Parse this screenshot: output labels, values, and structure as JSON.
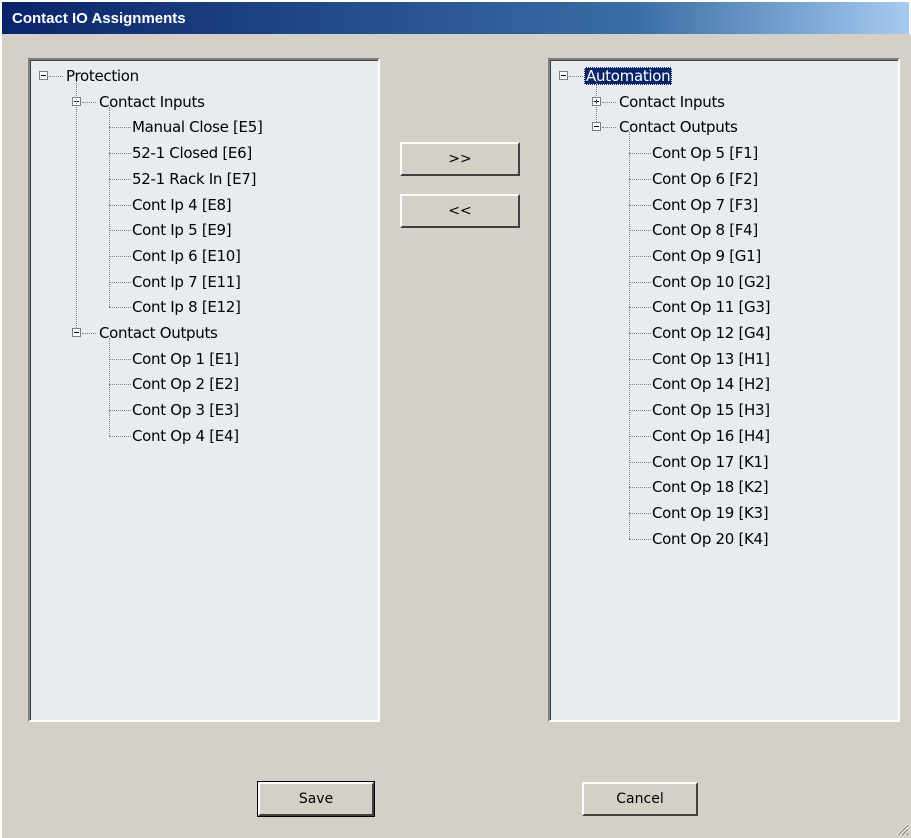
{
  "window": {
    "title": "Contact IO Assignments"
  },
  "left_tree": {
    "root": "Protection",
    "groups": [
      {
        "label": "Contact Inputs",
        "expanded": true,
        "items": [
          "Manual Close [E5]",
          "52-1 Closed [E6]",
          "52-1 Rack In [E7]",
          "Cont Ip 4 [E8]",
          "Cont Ip 5 [E9]",
          "Cont Ip 6 [E10]",
          "Cont Ip 7 [E11]",
          "Cont Ip 8 [E12]"
        ]
      },
      {
        "label": "Contact Outputs",
        "expanded": true,
        "items": [
          "Cont Op 1 [E1]",
          "Cont Op 2 [E2]",
          "Cont Op 3 [E3]",
          "Cont Op 4 [E4]"
        ]
      }
    ]
  },
  "right_tree": {
    "root": "Automation",
    "root_selected": true,
    "groups": [
      {
        "label": "Contact Inputs",
        "expanded": false,
        "items": []
      },
      {
        "label": "Contact Outputs",
        "expanded": true,
        "items": [
          "Cont Op 5 [F1]",
          "Cont Op 6 [F2]",
          "Cont Op 7 [F3]",
          "Cont Op 8 [F4]",
          "Cont Op 9 [G1]",
          "Cont Op 10 [G2]",
          "Cont Op 11 [G3]",
          "Cont Op 12 [G4]",
          "Cont Op 13 [H1]",
          "Cont Op 14 [H2]",
          "Cont Op 15 [H3]",
          "Cont Op 16 [H4]",
          "Cont Op 17 [K1]",
          "Cont Op 18 [K2]",
          "Cont Op 19 [K3]",
          "Cont Op 20 [K4]"
        ]
      }
    ]
  },
  "buttons": {
    "move_right": ">>",
    "move_left": "<<",
    "save": "Save",
    "cancel": "Cancel"
  }
}
